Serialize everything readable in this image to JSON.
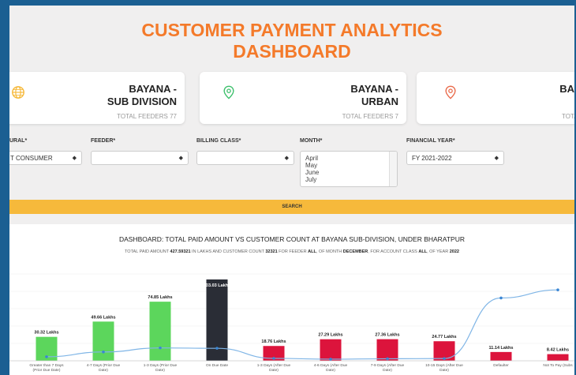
{
  "title_line1": "CUSTOMER PAYMENT ANALYTICS",
  "title_line2": "DASHBOARD",
  "cards": [
    {
      "name1": "BAYANA -",
      "name2": "SUB DIVISION",
      "total": "TOTAL FEEDERS 77",
      "icon": "globe-icon",
      "color": "#f6b93b"
    },
    {
      "name1": "BAYANA -",
      "name2": "URBAN",
      "total": "TOTAL FEEDERS 7",
      "icon": "map-pin-icon",
      "color": "#3bbf6a"
    },
    {
      "name1": "BA",
      "name2": "",
      "total": "TOTAL",
      "icon": "map-pin-icon",
      "color": "#e96a4a"
    }
  ],
  "filters": {
    "rural_label": "URAL*",
    "rural_value": "T CONSUMER",
    "feeder_label": "FEEDER*",
    "feeder_value": "",
    "billing_label": "BILLING CLASS*",
    "billing_value": "",
    "month_label": "MONTH*",
    "month_options": [
      "April",
      "May",
      "June",
      "July"
    ],
    "fy_label": "FINANCIAL YEAR*",
    "fy_value": "FY 2021-2022"
  },
  "search_label": "SEARCH",
  "dashboard_title": "DASHBOARD: TOTAL PAID AMOUNT VS CUSTOMER COUNT AT BAYANA SUB-DIVISION, UNDER BHARATPUR",
  "subtitle": {
    "p1": "TOTAL PAID AMOUNT ",
    "amount": "427.59321",
    "p2": " IN LAKHS AND CUSTOMER COUNT ",
    "count": "32321",
    "p3": " FOR FEEDER ",
    "feeder": "ALL",
    "p4": ", OF MONTH ",
    "month": "DECEMBER",
    "p5": ", FOR ACCOUNT CLASS ",
    "cls": "ALL",
    "p6": ", OF YEAR ",
    "year": "2022"
  },
  "chart_data": {
    "type": "bar",
    "categories": [
      "Greater than 7 Days\n(Prior Due Date)",
      "4-7 Days (Prior Due\nDate)",
      "1-3 Days (Prior Due\nDate)",
      "On Due Date",
      "1-3 Days (After Due\nDate)",
      "4-6 Days (After Due\nDate)",
      "7-9 Days (After Due\nDate)",
      "10-15 Days (After Due\nDate)",
      "Defaulter",
      "Not To Pay (Subs"
    ],
    "values": [
      30.32,
      49.66,
      74.85,
      103.03,
      18.76,
      27.29,
      27.36,
      24.77,
      11.14,
      8.42
    ],
    "value_labels": [
      "30.32 Lakhs",
      "49.66 Lakhs",
      "74.85 Lakhs",
      "103.03 Lakhs",
      "18.76 Lakhs",
      "27.29 Lakhs",
      "27.36 Lakhs",
      "24.77 Lakhs",
      "11.14 Lakhs",
      "8.42 Lakhs"
    ],
    "bar_colors": [
      "#5cd65c",
      "#5cd65c",
      "#5cd65c",
      "#2a2d36",
      "#dc143c",
      "#dc143c",
      "#dc143c",
      "#dc143c",
      "#dc143c",
      "#dc143c"
    ],
    "line_values": [
      500,
      1100,
      1600,
      1550,
      300,
      200,
      250,
      280,
      7800,
      8800
    ],
    "line_color": "#7fb5e6",
    "ylim": [
      0,
      110
    ]
  }
}
